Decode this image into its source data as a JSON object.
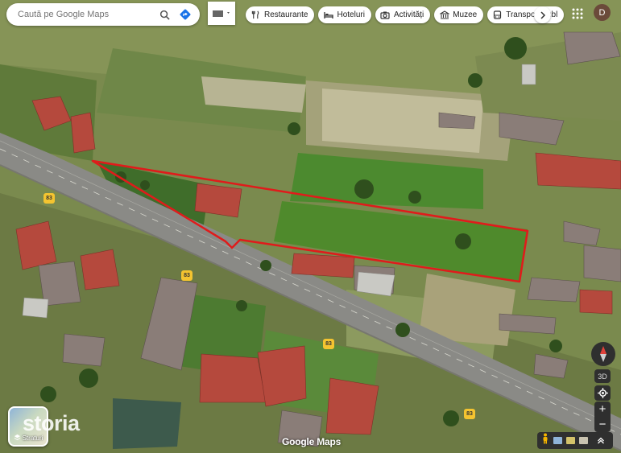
{
  "search": {
    "placeholder": "Caută pe Google Maps",
    "search_icon": "search-icon",
    "directions_icon": "directions-icon"
  },
  "chips": [
    {
      "label": "Restaurante",
      "icon": "fork-knife-icon"
    },
    {
      "label": "Hoteluri",
      "icon": "bed-icon"
    },
    {
      "label": "Activități",
      "icon": "camera-icon"
    },
    {
      "label": "Muzee",
      "icon": "museum-icon"
    },
    {
      "label": "Transport publ",
      "icon": "bus-icon"
    }
  ],
  "account": {
    "initial": "D"
  },
  "layers": {
    "label": "Straturi"
  },
  "watermark": "storia",
  "attribution": "Google Maps",
  "controls": {
    "three_d": "3D",
    "zoom_in": "+",
    "zoom_out": "−"
  },
  "road_shields": [
    "83",
    "83",
    "83",
    "83"
  ],
  "colors": {
    "boundary": "#e01b1b",
    "road": "#8a8a86",
    "grass": "#5d8a2e",
    "roof": "#b5493d"
  }
}
